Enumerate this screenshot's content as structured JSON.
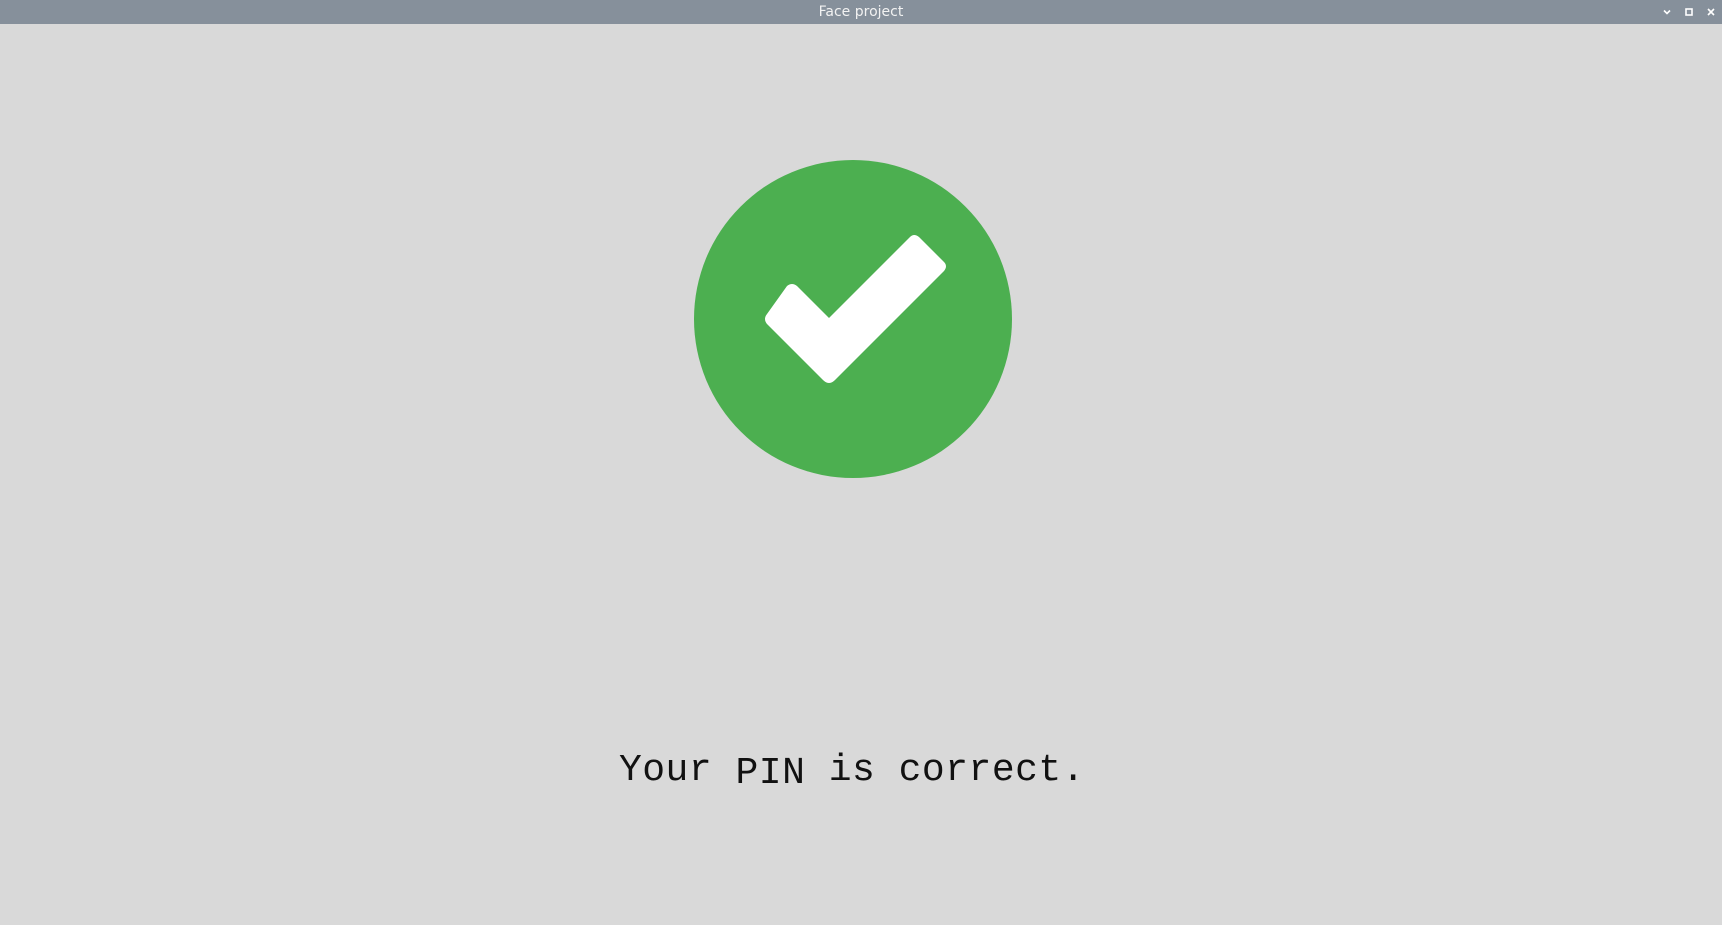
{
  "window": {
    "title": "Face project",
    "controls": [
      {
        "icon": "chevron-down-icon"
      },
      {
        "icon": "maximize-icon"
      },
      {
        "icon": "close-icon"
      }
    ]
  },
  "main": {
    "status_icon": "checkmark-circle-icon",
    "status_color": "#4caf50",
    "message_parts": {
      "before": "Your ",
      "pin": "PIN",
      "after": " is correct."
    }
  }
}
